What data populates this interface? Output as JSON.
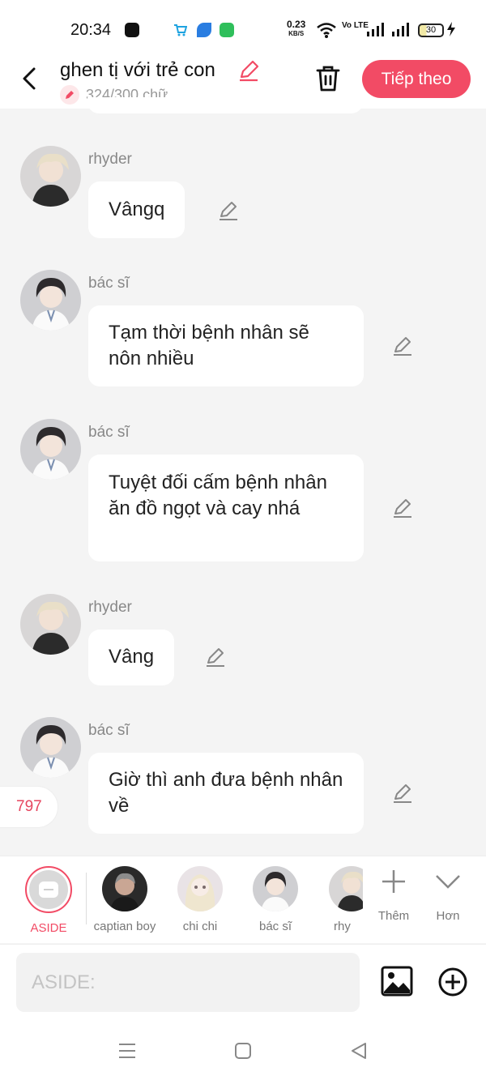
{
  "status_bar": {
    "time": "20:34",
    "net_speed": "0.23",
    "net_unit": "KB/S",
    "volte": "Vo LTE",
    "battery": "30"
  },
  "header": {
    "title": "ghen tị với trẻ con",
    "word_count": "324/300 chữ",
    "next_label": "Tiếp theo"
  },
  "messages": [
    {
      "sender": "rhyder",
      "text": "Vângq"
    },
    {
      "sender": "bác sĩ",
      "text": "Tạm thời bệnh nhân sẽ nôn nhiều"
    },
    {
      "sender": "bác sĩ",
      "text": "Tuyệt đối cấm bệnh nhân ăn đồ ngọt và cay nhá"
    },
    {
      "sender": "rhyder",
      "text": "Vâng"
    },
    {
      "sender": "bác sĩ",
      "text": "Giờ thì anh đưa bệnh nhân về"
    }
  ],
  "counter": "797",
  "characters": [
    {
      "name": "ASIDE",
      "selected": true
    },
    {
      "name": "captian boy"
    },
    {
      "name": "chi chi"
    },
    {
      "name": "bác sĩ"
    },
    {
      "name": "rhy"
    }
  ],
  "tools": {
    "more_label": "Thêm",
    "collapse_label": "Hơn"
  },
  "input": {
    "placeholder": "ASIDE:"
  },
  "colors": {
    "accent": "#f24b65",
    "background": "#f4f4f4",
    "bubble": "#ffffff"
  }
}
